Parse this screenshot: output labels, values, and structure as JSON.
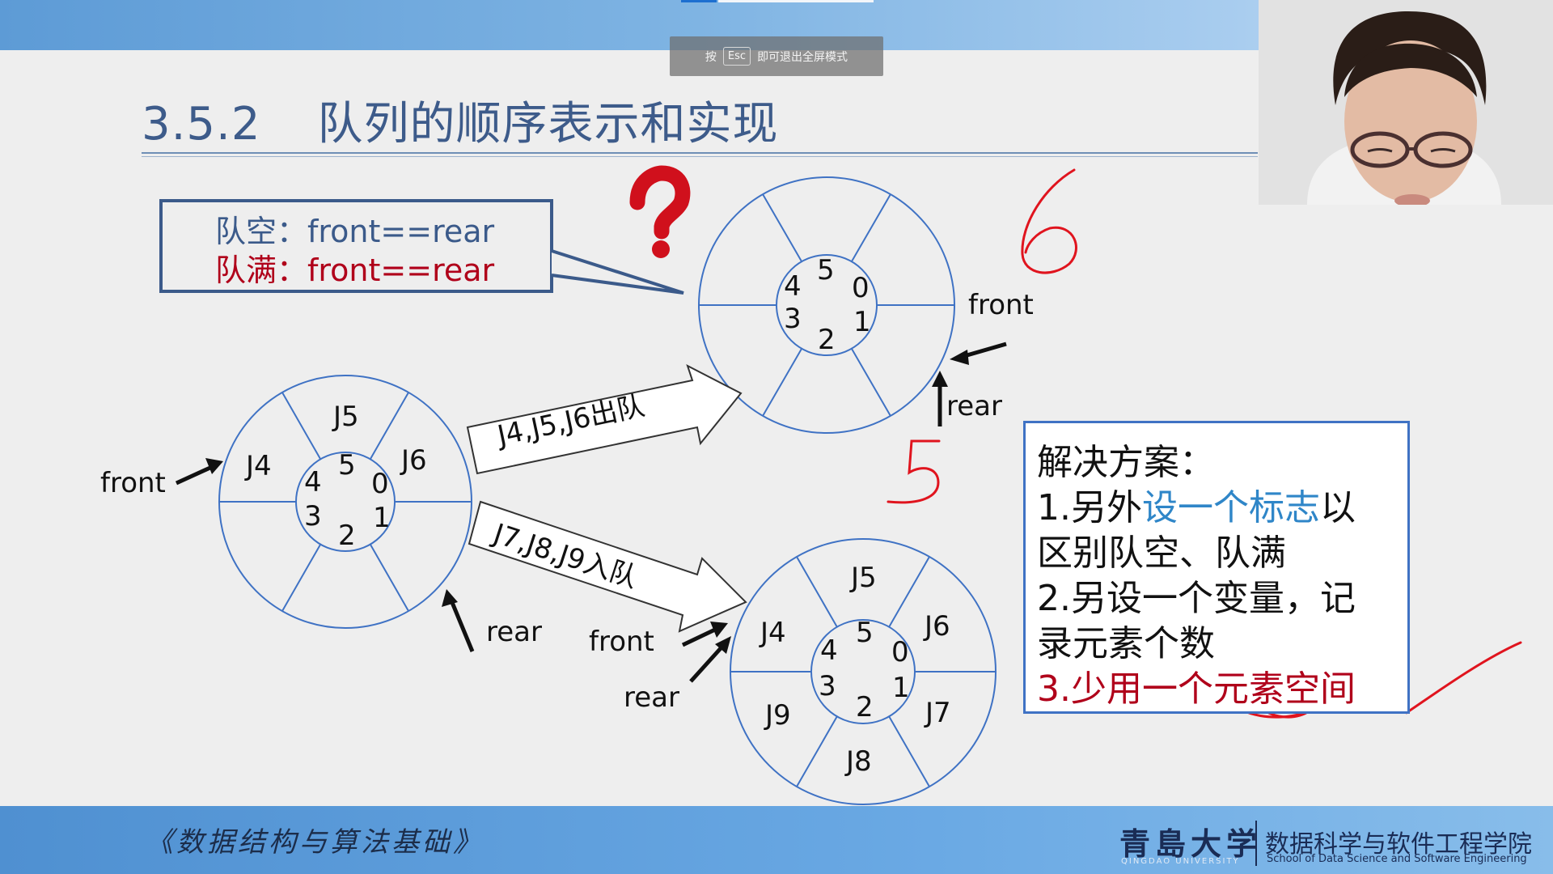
{
  "esc_tip": {
    "prefix": "按",
    "key": "Esc",
    "suffix": "即可退出全屏模式"
  },
  "title": {
    "number": "3.5.2",
    "text": "队列的顺序表示和实现"
  },
  "callout": {
    "empty_label": "队空：",
    "empty_cond": "front==rear",
    "full_label": "队满：",
    "full_cond": "front==rear"
  },
  "colors": {
    "title": "#3d5b8a",
    "ring": "#3f72c4",
    "callout_blue": "#3b5a8a",
    "callout_red": "#b0001a",
    "annotation_red": "#e0141e",
    "question_mark": "#d0101c"
  },
  "left_queue": {
    "slots": {
      "top": "J5",
      "upper_left": "J4",
      "upper_right": "J6"
    },
    "indices": [
      "5",
      "4",
      "0",
      "3",
      "1",
      "2"
    ],
    "front_label": "front",
    "rear_label": "rear"
  },
  "top_queue": {
    "indices": [
      "5",
      "4",
      "0",
      "3",
      "1",
      "2"
    ],
    "front_label": "front",
    "rear_label": "rear"
  },
  "bottom_queue": {
    "slots": {
      "top": "J5",
      "upper_left": "J4",
      "upper_right": "J6",
      "lower_left": "J9",
      "lower_right": "J7",
      "bottom": "J8"
    },
    "indices": [
      "5",
      "4",
      "0",
      "3",
      "1",
      "2"
    ],
    "front_label": "front",
    "rear_label": "rear"
  },
  "arrows": {
    "dequeue": "J4,J5,J6出队",
    "enqueue": "J7,J8,J9入队"
  },
  "handwriting": {
    "six": "6",
    "five": "5"
  },
  "solution": {
    "title": "解决方案：",
    "line1_a": "1.另外",
    "line1_b": "设一个标志",
    "line1_c": "以",
    "line2": "区别队空、队满",
    "line3": "2.另设一个变量，记",
    "line4": "录元素个数",
    "line5": "3.少用一个元素空间"
  },
  "footer": {
    "book": "《数据结构与算法基础》",
    "university": "青島大学",
    "university_en": "QINGDAO UNIVERSITY",
    "school": "数据科学与软件工程学院",
    "school_en": "School of Data Science and Software Engineering"
  },
  "icons": [
    "question-mark-icon",
    "university-logo-icon",
    "webcam-feed"
  ]
}
